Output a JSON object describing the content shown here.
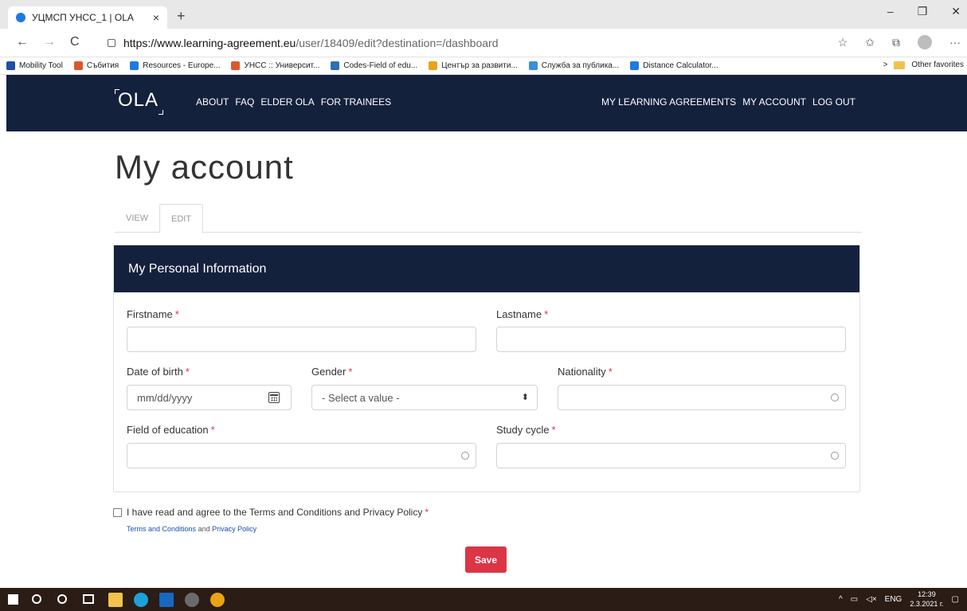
{
  "browser": {
    "tab_title": "УЦМСП УНСС_1 | OLA",
    "tab_close": "×",
    "new_tab": "+",
    "win_min": "–",
    "win_max": "❐",
    "win_close": "✕",
    "back": "←",
    "forward": "→",
    "reload": "C",
    "url_host": "https://www.learning-agreement.eu",
    "url_path": "/user/18409/edit?destination=/dashboard",
    "more": "···",
    "favorites": [
      {
        "label": "Mobility Tool",
        "color": "#1f4fa8"
      },
      {
        "label": "Събития",
        "color": "#d9592c"
      },
      {
        "label": "Resources - Europe...",
        "color": "#1f7ae0"
      },
      {
        "label": "УНСС :: Университ...",
        "color": "#d9592c"
      },
      {
        "label": "Codes-Field of edu...",
        "color": "#2f6fb3"
      },
      {
        "label": "Център за развити...",
        "color": "#e8a317"
      },
      {
        "label": "Служба за публика...",
        "color": "#3b8fd6"
      },
      {
        "label": "Distance Calculator...",
        "color": "#1f7ae0"
      }
    ],
    "fav_chevron": ">",
    "other_favorites": "Other favorites"
  },
  "site": {
    "logo": "OLA",
    "nav_left": [
      "ABOUT",
      "FAQ",
      "ELDER OLA",
      "FOR TRAINEES"
    ],
    "nav_right": [
      "MY LEARNING AGREEMENTS",
      "MY ACCOUNT",
      "LOG OUT"
    ]
  },
  "page": {
    "title": "My account",
    "tabs": [
      "VIEW",
      "EDIT"
    ],
    "active_tab": "EDIT"
  },
  "form": {
    "section_title": "My Personal Information",
    "required_mark": "*",
    "firstname_label": "Firstname",
    "lastname_label": "Lastname",
    "dob_label": "Date of birth",
    "dob_placeholder": "mm/dd/yyyy",
    "gender_label": "Gender",
    "gender_selected": "- Select a value -",
    "nationality_label": "Nationality",
    "field_of_education_label": "Field of education",
    "study_cycle_label": "Study cycle",
    "terms_text": "I have read and agree to the Terms and Conditions and Privacy Policy",
    "terms_link": "Terms and Conditions",
    "terms_and": "and",
    "privacy_link": "Privacy Policy",
    "save_label": "Save"
  },
  "taskbar": {
    "lang": "ENG",
    "time": "12:39",
    "date": "2.3.2021 г."
  }
}
